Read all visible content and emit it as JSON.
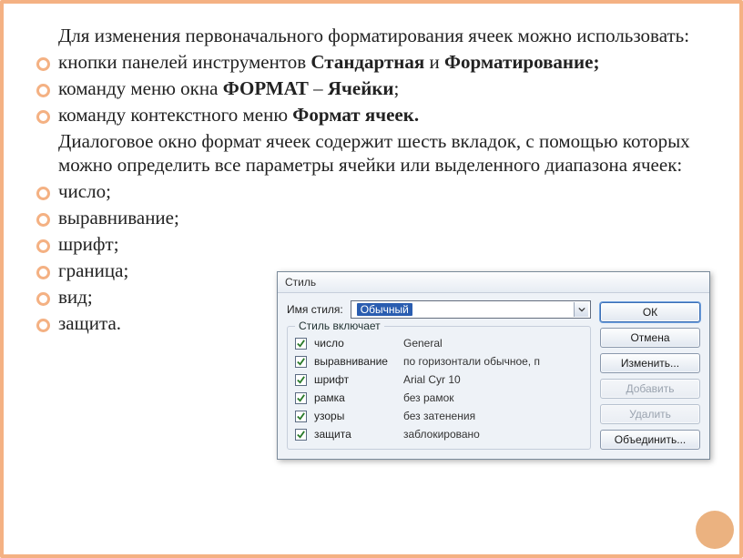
{
  "intro": "Для изменения первоначального форматирования ячеек можно использовать:",
  "bullets_top": [
    {
      "pre": "кнопки панелей инструментов ",
      "b1": "Стандартная",
      "mid": " и ",
      "b2": "Форматирование;"
    },
    {
      "pre": "команду меню окна ",
      "b1": "ФОРМАТ",
      "mid": " – ",
      "b2": "Ячейки",
      "post": ";"
    },
    {
      "pre": "команду контекстного меню ",
      "b1": "Формат ячеек."
    }
  ],
  "para": "Диалоговое окно формат ячеек содержит шесть вкладок, с помощью которых можно определить все параметры ячейки или выделенного диапазона ячеек:",
  "bullets_bottom": [
    "число;",
    "выравнивание;",
    "шрифт;",
    "граница;",
    "вид;",
    "защита."
  ],
  "dialog": {
    "title": "Стиль",
    "style_label": "Имя стиля:",
    "style_value": "Обычный",
    "group_legend": "Стиль включает",
    "rows": [
      {
        "label": "число",
        "desc": "General"
      },
      {
        "label": "выравнивание",
        "desc": "по горизонтали обычное, п"
      },
      {
        "label": "шрифт",
        "desc": "Arial Cyr 10"
      },
      {
        "label": "рамка",
        "desc": "без рамок"
      },
      {
        "label": "узоры",
        "desc": "без затенения"
      },
      {
        "label": "защита",
        "desc": "заблокировано"
      }
    ],
    "buttons": {
      "ok": "ОК",
      "cancel": "Отмена",
      "change": "Изменить...",
      "add": "Добавить",
      "delete": "Удалить",
      "merge": "Объединить..."
    }
  }
}
